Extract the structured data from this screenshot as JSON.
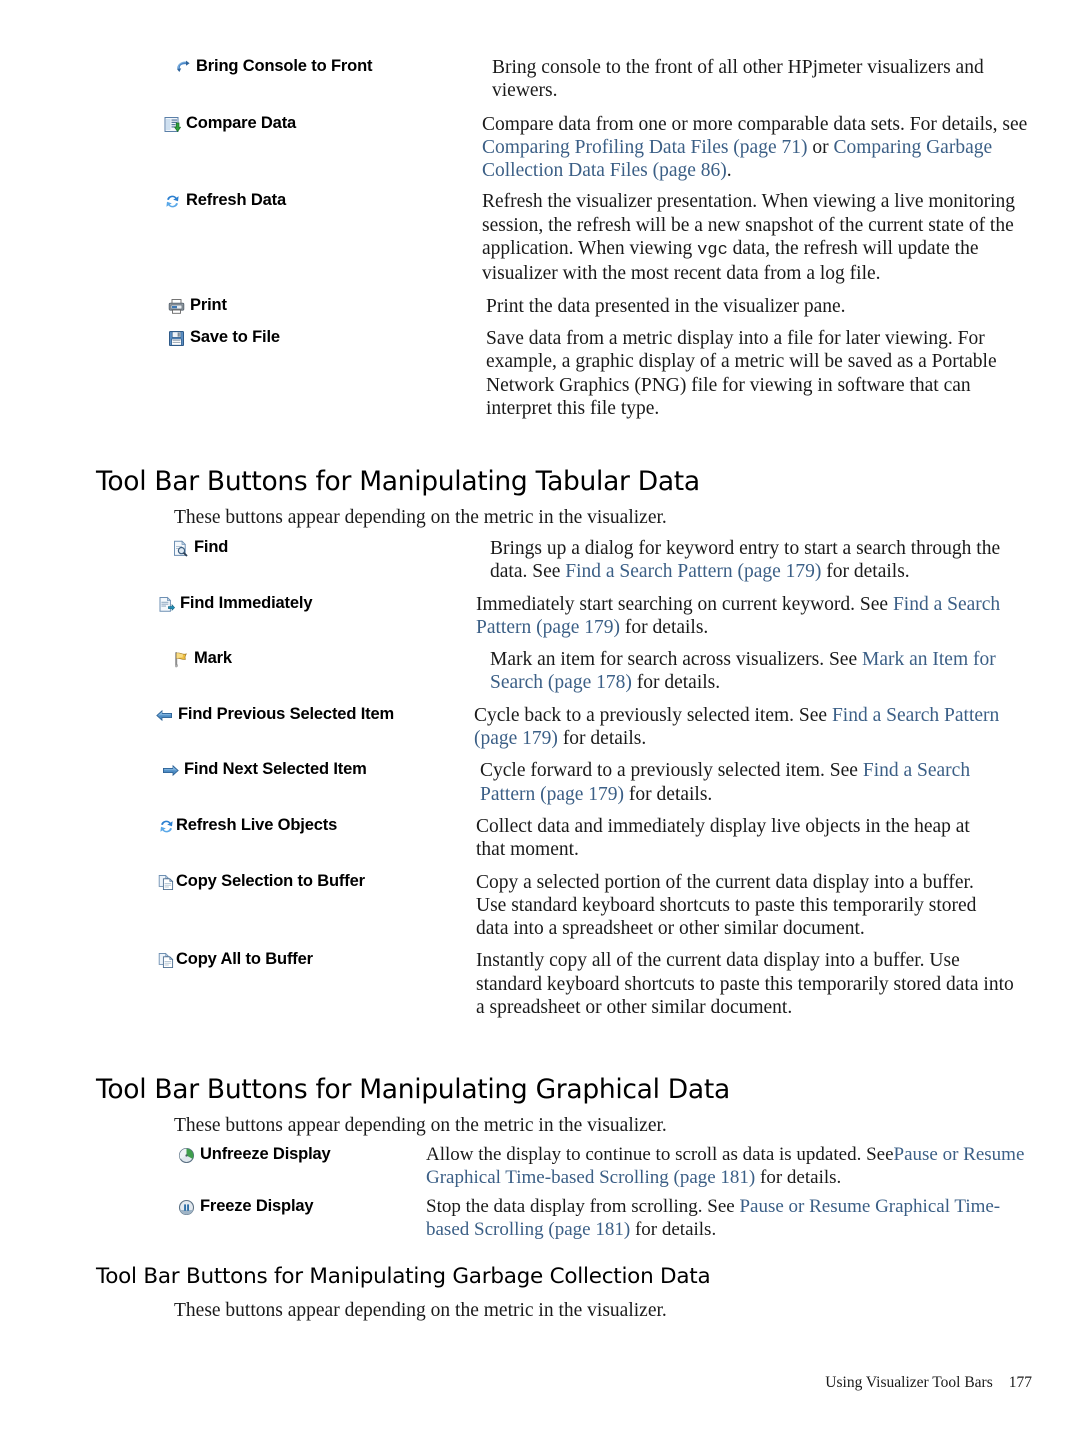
{
  "page": {
    "footer_text": "Using Visualizer Tool Bars",
    "page_number": "177"
  },
  "colors": {
    "link": "#3b5f86",
    "text": "#1a1a1a",
    "background": "#ffffff"
  },
  "console_section": {
    "rows": [
      {
        "icon": "bring-to-front-icon",
        "term": "Bring Console to Front",
        "desc_parts": [
          {
            "t": "Bring console to the front of all other HPjmeter visualizers and viewers.",
            "link": false
          }
        ]
      },
      {
        "icon": "compare-data-icon",
        "term": "Compare Data",
        "desc_parts": [
          {
            "t": "Compare data from one or more comparable data sets. For details, see ",
            "link": false
          },
          {
            "t": "Comparing Profiling Data Files (page 71)",
            "link": true
          },
          {
            "t": " or ",
            "link": false
          },
          {
            "t": "Comparing Garbage Collection Data Files (page 86)",
            "link": true
          },
          {
            "t": ".",
            "link": false
          }
        ]
      },
      {
        "icon": "refresh-data-icon",
        "term": "Refresh Data",
        "desc_parts": [
          {
            "t": "Refresh the visualizer presentation. When viewing a live monitoring session, the refresh will be a new snapshot of the current state of the application. When viewing ",
            "link": false
          },
          {
            "t": "vgc",
            "mono": true
          },
          {
            "t": " data, the refresh will update the visualizer with the most recent data from a log file.",
            "link": false
          }
        ]
      },
      {
        "icon": "print-icon",
        "term": "Print",
        "desc_parts": [
          {
            "t": "Print the data presented in the visualizer pane.",
            "link": false
          }
        ]
      },
      {
        "icon": "save-to-file-icon",
        "term": "Save to File",
        "desc_parts": [
          {
            "t": "Save data from a metric display into a file for later viewing. For example, a graphic display of a metric will be saved as a Portable Network Graphics (PNG) file for viewing in software that can interpret this file type.",
            "link": false
          }
        ]
      }
    ]
  },
  "tabular_section": {
    "heading": "Tool Bar Buttons for Manipulating Tabular Data",
    "intro": "These buttons appear depending on the metric in the visualizer.",
    "rows": [
      {
        "icon": "find-icon",
        "term": "Find",
        "desc_parts": [
          {
            "t": "Brings up a dialog for keyword entry to start a search through the data. See ",
            "link": false
          },
          {
            "t": "Find a Search Pattern (page 179)",
            "link": true
          },
          {
            "t": " for details.",
            "link": false
          }
        ]
      },
      {
        "icon": "find-immediately-icon",
        "term": "Find Immediately",
        "desc_parts": [
          {
            "t": "Immediately start searching on current keyword. See ",
            "link": false
          },
          {
            "t": "Find a Search Pattern (page 179)",
            "link": true
          },
          {
            "t": " for details.",
            "link": false
          }
        ]
      },
      {
        "icon": "mark-flag-icon",
        "term": "Mark",
        "desc_parts": [
          {
            "t": "Mark an item for search across visualizers. See ",
            "link": false
          },
          {
            "t": "Mark an Item for Search (page 178)",
            "link": true
          },
          {
            "t": " for details.",
            "link": false
          }
        ]
      },
      {
        "icon": "arrow-left-icon",
        "term": "Find Previous Selected Item",
        "desc_parts": [
          {
            "t": "Cycle back to a previously selected item. See ",
            "link": false
          },
          {
            "t": "Find a Search Pattern (page 179)",
            "link": true
          },
          {
            "t": " for details.",
            "link": false
          }
        ]
      },
      {
        "icon": "arrow-right-icon",
        "term": "Find Next Selected Item",
        "desc_parts": [
          {
            "t": "Cycle forward to a previously selected item. See ",
            "link": false
          },
          {
            "t": "Find a Search Pattern (page 179)",
            "link": true
          },
          {
            "t": " for details.",
            "link": false
          }
        ]
      },
      {
        "icon": "refresh-live-objects-icon",
        "term": "Refresh Live Objects",
        "desc_parts": [
          {
            "t": "Collect data and immediately display live objects in the heap at that moment.",
            "link": false
          }
        ]
      },
      {
        "icon": "copy-selection-icon",
        "term": "Copy Selection to Buffer",
        "desc_parts": [
          {
            "t": "Copy a selected portion of the current data display into a buffer. Use standard keyboard shortcuts to paste this temporarily stored data into a spreadsheet or other similar document.",
            "link": false
          }
        ]
      },
      {
        "icon": "copy-all-icon",
        "term": "Copy All to Buffer",
        "desc_parts": [
          {
            "t": "Instantly copy all of the current data display into a buffer. Use standard keyboard shortcuts to paste this temporarily stored data into a spreadsheet or other similar document.",
            "link": false
          }
        ]
      }
    ]
  },
  "graphical_section": {
    "heading": "Tool Bar Buttons for Manipulating Graphical Data",
    "intro": "These buttons appear depending on the metric in the visualizer.",
    "rows": [
      {
        "icon": "unfreeze-display-icon",
        "term": "Unfreeze Display",
        "desc_parts": [
          {
            "t": "Allow the display to continue to scroll as data is updated. See",
            "link": false
          },
          {
            "t": "Pause or Resume Graphical Time-based Scrolling (page 181)",
            "link": true
          },
          {
            "t": " for details.",
            "link": false
          }
        ]
      },
      {
        "icon": "freeze-display-icon",
        "term": "Freeze Display",
        "desc_parts": [
          {
            "t": "Stop the data display from scrolling. See ",
            "link": false
          },
          {
            "t": "Pause or Resume Graphical Time-based Scrolling (page 181)",
            "link": true
          },
          {
            "t": " for details.",
            "link": false
          }
        ]
      }
    ]
  },
  "gc_section": {
    "heading": "Tool Bar Buttons for Manipulating Garbage Collection Data",
    "intro": "These buttons appear depending on the metric in the visualizer."
  }
}
